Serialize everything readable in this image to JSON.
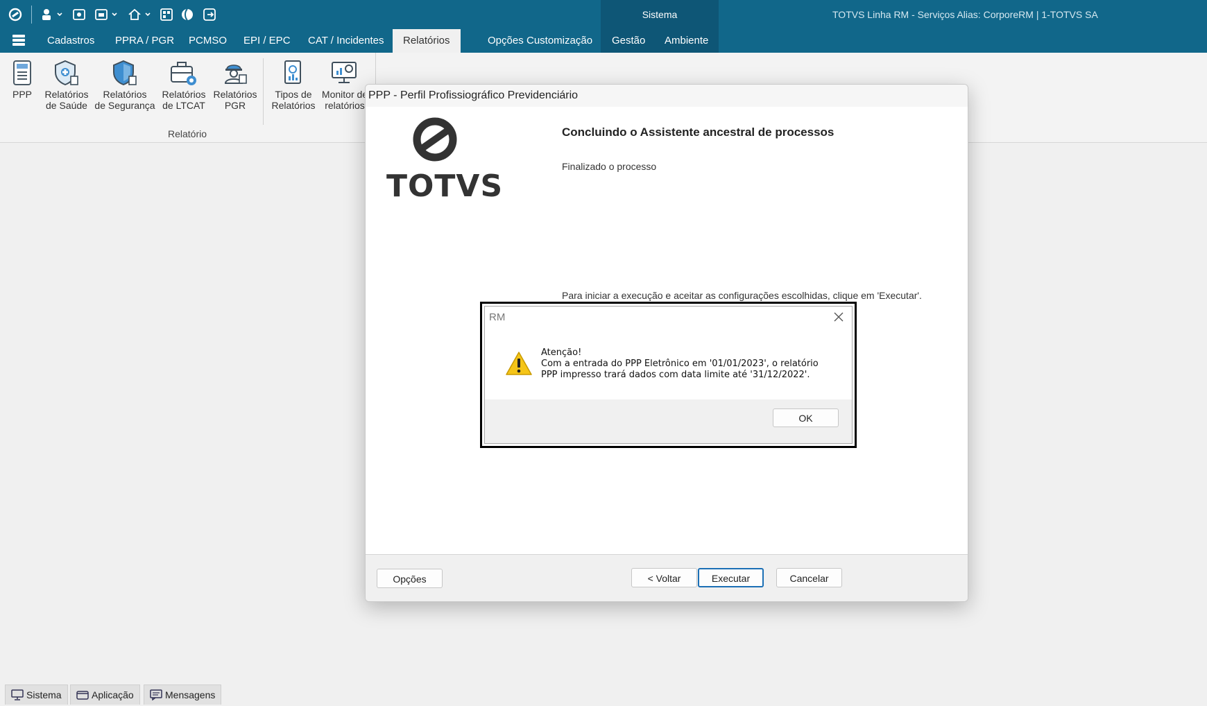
{
  "titlebar": {
    "section": "Sistema",
    "app_title": "TOTVS Linha RM - Serviços  Alias: CorporeRM | 1-TOTVS SA",
    "accent": "#11678a"
  },
  "menu": {
    "items": [
      "Cadastros",
      "PPRA / PGR",
      "PCMSO",
      "EPI / EPC",
      "CAT / Incidentes",
      "Relatórios",
      "Opções",
      "Customização",
      "Gestão",
      "Ambiente"
    ],
    "active": "Relatórios"
  },
  "ribbon": {
    "buttons": [
      {
        "line1": "PPP",
        "line2": "",
        "icon": "ppp-document-icon"
      },
      {
        "line1": "Relatórios",
        "line2": "de Saúde",
        "icon": "health-shield-icon"
      },
      {
        "line1": "Relatórios",
        "line2": "de Segurança",
        "icon": "security-shield-icon"
      },
      {
        "line1": "Relatórios",
        "line2": "de LTCAT",
        "icon": "ltcat-briefcase-icon"
      },
      {
        "line1": "Relatórios",
        "line2": "PGR",
        "icon": "pgr-worker-icon"
      },
      {
        "line1": "Tipos de",
        "line2": "Relatórios",
        "icon": "report-types-icon"
      },
      {
        "line1": "Monitor de",
        "line2": "relatórios",
        "icon": "report-monitor-icon"
      }
    ],
    "group_label": "Relatório"
  },
  "wizard": {
    "title": "PPP - Perfil Profissiográfico Previdenciário",
    "logo": "TOTVS",
    "heading": "Concluindo o Assistente ancestral de processos",
    "subheading": "Finalizado o processo",
    "hint": "Para iniciar a execução e aceitar as configurações escolhidas, clique em 'Executar'.",
    "buttons": {
      "options": "Opções",
      "back": "< Voltar",
      "execute": "Executar",
      "cancel": "Cancelar"
    }
  },
  "alert": {
    "title": "RM",
    "message": "Atenção!\nCom a entrada do PPP Eletrônico em '01/01/2023', o relatório\nPPP impresso trará dados com data limite até '31/12/2022'.",
    "ok": "OK",
    "icon": "warning-icon"
  },
  "statusbar": {
    "tabs": [
      {
        "label": "Sistema",
        "icon": "monitor-icon"
      },
      {
        "label": "Aplicação",
        "icon": "application-icon"
      },
      {
        "label": "Mensagens",
        "icon": "messages-icon"
      }
    ]
  }
}
